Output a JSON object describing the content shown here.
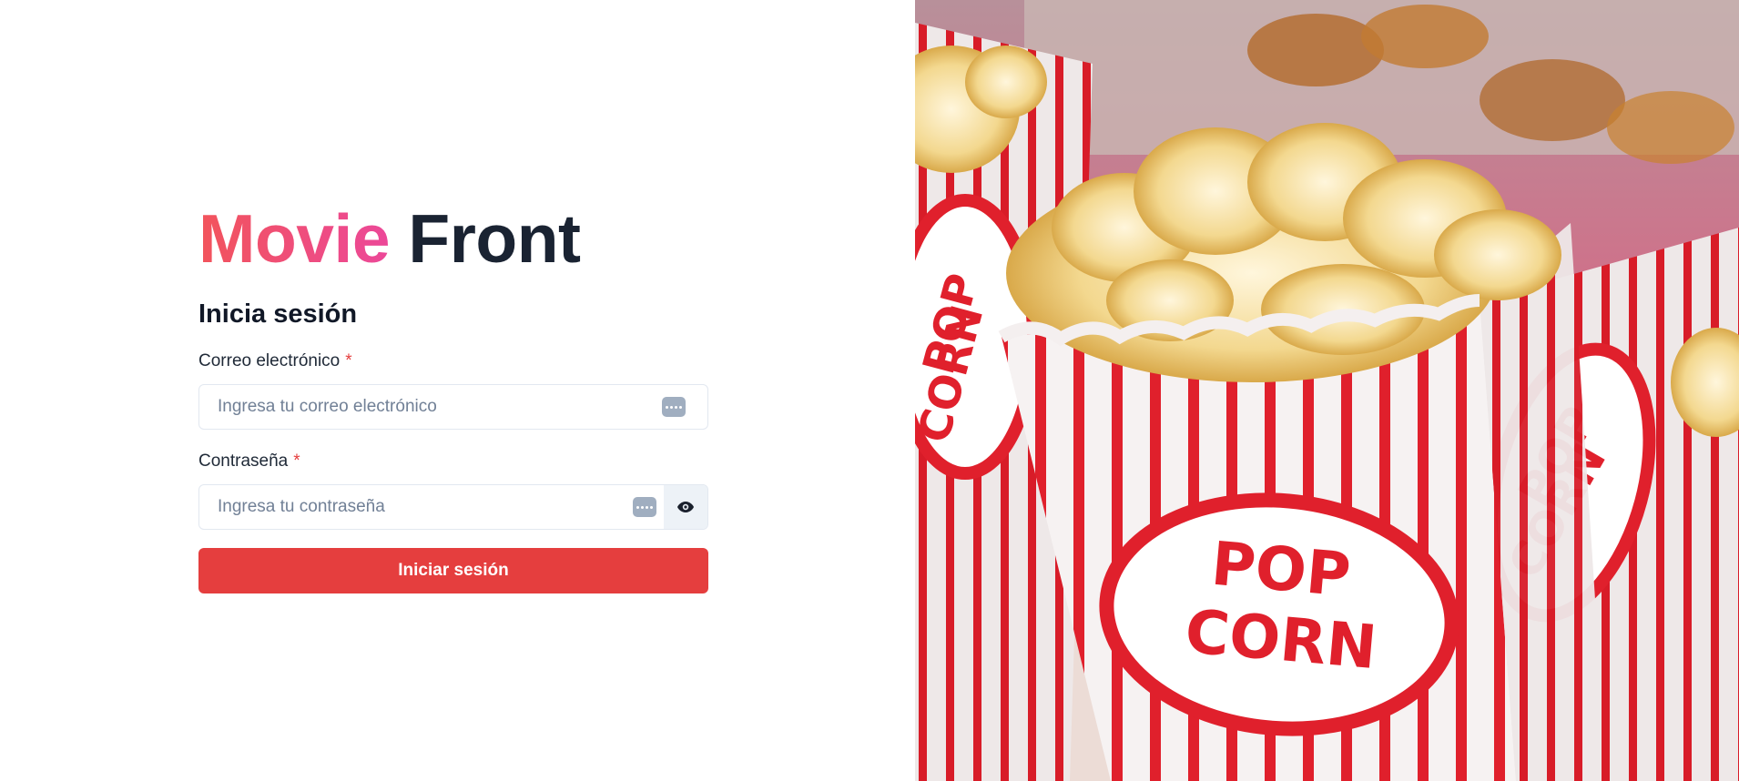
{
  "brand": {
    "accent": "Movie",
    "main": "Front"
  },
  "form": {
    "title": "Inicia sesión",
    "email": {
      "label": "Correo electrónico",
      "required_mark": "*",
      "placeholder": "Ingresa tu correo electrónico",
      "value": ""
    },
    "password": {
      "label": "Contraseña",
      "required_mark": "*",
      "placeholder": "Ingresa tu contraseña",
      "value": ""
    },
    "submit_label": "Iniciar sesión"
  },
  "icons": {
    "autofill": "password-manager-icon",
    "reveal": "eye-icon"
  },
  "colors": {
    "brand_gradient_start": "#f2545b",
    "brand_gradient_end": "#ec4899",
    "brand_dark": "#1a2332",
    "primary": "#e53e3e",
    "required": "#e53e3e"
  },
  "hero": {
    "subject": "popcorn",
    "box_text": [
      "POP",
      "CORN"
    ]
  }
}
